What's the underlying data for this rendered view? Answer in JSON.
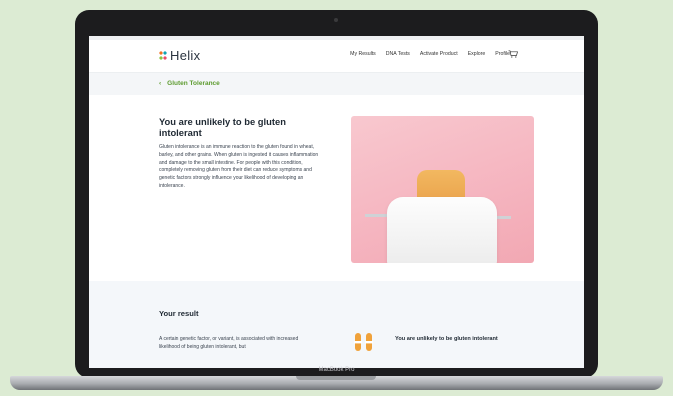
{
  "device": {
    "label": "MacBook Pro"
  },
  "nav": {
    "logo": "Helix",
    "links": [
      "My Results",
      "DNA Tests",
      "Activate Product",
      "Explore",
      "Profile"
    ],
    "icons": [
      "logo-mark-icon",
      "cart-icon"
    ]
  },
  "subnav": {
    "back_label": "Gluten Tolerance",
    "icon": "chevron-left-icon"
  },
  "hero": {
    "title": "You are unlikely to be gluten intolerant",
    "body": "Gluten intolerance is an immune reaction to the gluten found in wheat, barley, and other grains. When gluten is ingested it causes inflammation and damage to the small intestine. For people with this condition, completely removing gluten from their diet can reduce symptoms and genetic factors strongly influence your likelihood of developing an intolerance.",
    "image": "toast-in-toaster-photo"
  },
  "results": {
    "title": "Your result",
    "body": "A certain genetic factor, or variant, is associated with increased likelihood of being gluten intolerant, but",
    "summary": "You are unlikely to be gluten intolerant",
    "icon": "gene-icon"
  },
  "colors": {
    "accent_green": "#5d9b2f",
    "gene_orange": "#f0a23a",
    "background": "#dcebd3"
  }
}
